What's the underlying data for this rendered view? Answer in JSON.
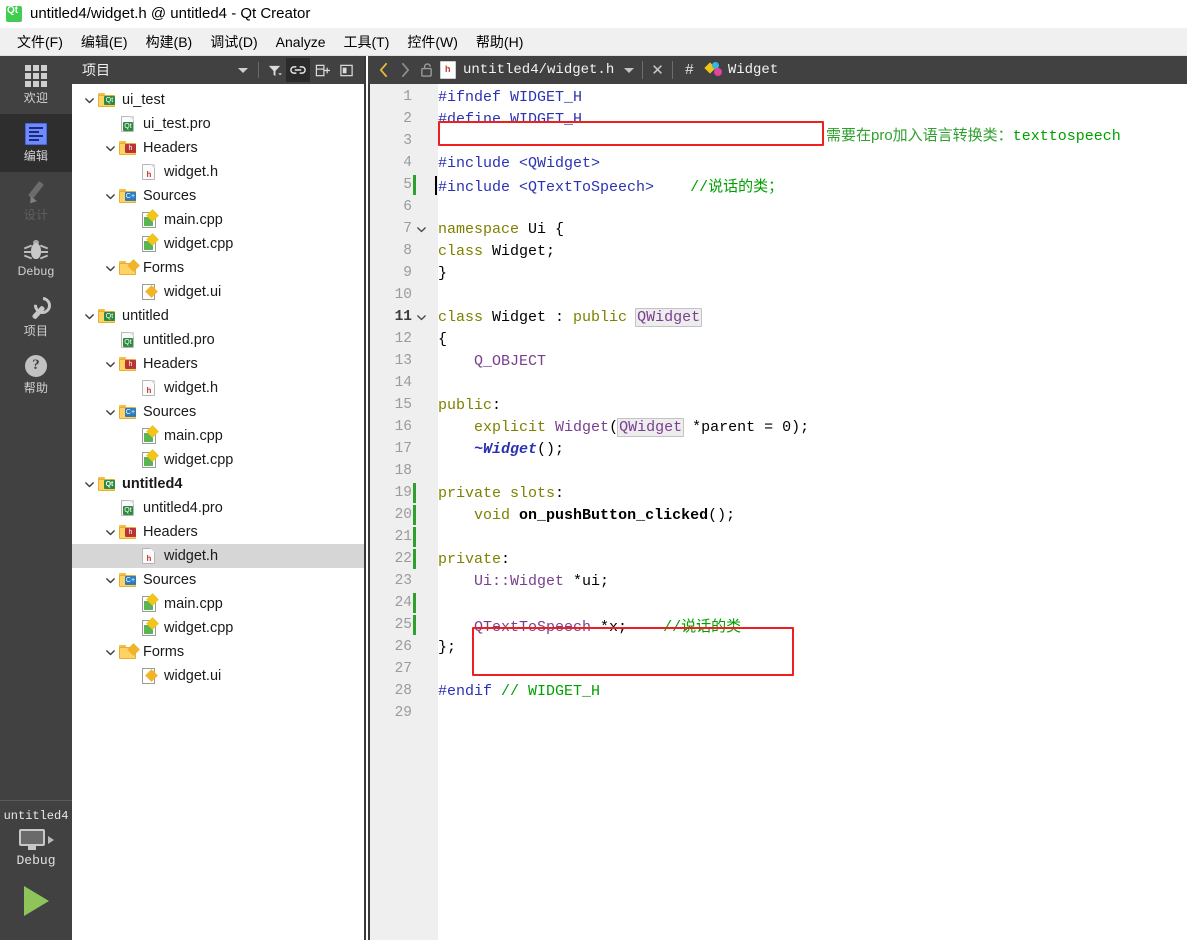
{
  "window": {
    "title": "untitled4/widget.h @ untitled4 - Qt Creator",
    "logo_icon": "qt-logo-icon"
  },
  "menubar": {
    "items": [
      {
        "label": "文件(F)",
        "mnemonic": "F"
      },
      {
        "label": "编辑(E)",
        "mnemonic": "E"
      },
      {
        "label": "构建(B)",
        "mnemonic": "B"
      },
      {
        "label": "调试(D)",
        "mnemonic": "D"
      },
      {
        "label": "Analyze",
        "mnemonic": "A"
      },
      {
        "label": "工具(T)",
        "mnemonic": "T"
      },
      {
        "label": "控件(W)",
        "mnemonic": "W"
      },
      {
        "label": "帮助(H)",
        "mnemonic": "H"
      }
    ]
  },
  "modebar": {
    "items": [
      {
        "label": "欢迎",
        "icon": "grid-icon",
        "state": "normal"
      },
      {
        "label": "编辑",
        "icon": "edit-document-icon",
        "state": "active"
      },
      {
        "label": "设计",
        "icon": "pencil-icon",
        "state": "disabled"
      },
      {
        "label": "Debug",
        "icon": "bug-icon",
        "state": "normal"
      },
      {
        "label": "项目",
        "icon": "wrench-icon",
        "state": "normal"
      },
      {
        "label": "帮助",
        "icon": "question-circle-icon",
        "state": "normal"
      }
    ],
    "kit": {
      "project": "untitled4",
      "build_config": "Debug",
      "target_icon": "monitor-icon",
      "arrow_icon": "chevron-right-icon",
      "run_icon": "run-play-icon"
    }
  },
  "project_panel": {
    "title": "项目",
    "toolbar": [
      {
        "name": "view-selector-caret",
        "icon": "chevron-down-icon"
      },
      {
        "name": "filter-button",
        "icon": "filter-icon"
      },
      {
        "name": "sync-with-editor-button",
        "icon": "link-icon",
        "active": true
      },
      {
        "name": "add-split-button",
        "icon": "split-add-icon"
      },
      {
        "name": "close-sidebar-button",
        "icon": "close-panel-icon"
      }
    ],
    "tree": [
      {
        "indent": 0,
        "label": "ui_test",
        "icon": "folder-qt-icon",
        "twisty": "expanded",
        "bold": false,
        "selected": false
      },
      {
        "indent": 1,
        "label": "ui_test.pro",
        "icon": "file-pro-icon",
        "twisty": "none",
        "bold": false,
        "selected": false
      },
      {
        "indent": 1,
        "label": "Headers",
        "icon": "folder-h-icon",
        "twisty": "expanded",
        "bold": false,
        "selected": false
      },
      {
        "indent": 2,
        "label": "widget.h",
        "icon": "file-h-icon",
        "twisty": "none",
        "bold": false,
        "selected": false
      },
      {
        "indent": 1,
        "label": "Sources",
        "icon": "folder-cpp-icon",
        "twisty": "expanded",
        "bold": false,
        "selected": false
      },
      {
        "indent": 2,
        "label": "main.cpp",
        "icon": "file-cpp-icon",
        "twisty": "none",
        "bold": false,
        "selected": false
      },
      {
        "indent": 2,
        "label": "widget.cpp",
        "icon": "file-cpp-icon",
        "twisty": "none",
        "bold": false,
        "selected": false
      },
      {
        "indent": 1,
        "label": "Forms",
        "icon": "folder-forms-icon",
        "twisty": "expanded",
        "bold": false,
        "selected": false
      },
      {
        "indent": 2,
        "label": "widget.ui",
        "icon": "file-ui-icon",
        "twisty": "none",
        "bold": false,
        "selected": false
      },
      {
        "indent": 0,
        "label": "untitled",
        "icon": "folder-qt-icon",
        "twisty": "expanded",
        "bold": false,
        "selected": false
      },
      {
        "indent": 1,
        "label": "untitled.pro",
        "icon": "file-pro-icon",
        "twisty": "none",
        "bold": false,
        "selected": false
      },
      {
        "indent": 1,
        "label": "Headers",
        "icon": "folder-h-icon",
        "twisty": "expanded",
        "bold": false,
        "selected": false
      },
      {
        "indent": 2,
        "label": "widget.h",
        "icon": "file-h-icon",
        "twisty": "none",
        "bold": false,
        "selected": false
      },
      {
        "indent": 1,
        "label": "Sources",
        "icon": "folder-cpp-icon",
        "twisty": "expanded",
        "bold": false,
        "selected": false
      },
      {
        "indent": 2,
        "label": "main.cpp",
        "icon": "file-cpp-icon",
        "twisty": "none",
        "bold": false,
        "selected": false
      },
      {
        "indent": 2,
        "label": "widget.cpp",
        "icon": "file-cpp-icon",
        "twisty": "none",
        "bold": false,
        "selected": false
      },
      {
        "indent": 0,
        "label": "untitled4",
        "icon": "folder-qt-icon",
        "twisty": "expanded",
        "bold": true,
        "selected": false
      },
      {
        "indent": 1,
        "label": "untitled4.pro",
        "icon": "file-pro-icon",
        "twisty": "none",
        "bold": false,
        "selected": false
      },
      {
        "indent": 1,
        "label": "Headers",
        "icon": "folder-h-icon",
        "twisty": "expanded",
        "bold": false,
        "selected": false
      },
      {
        "indent": 2,
        "label": "widget.h",
        "icon": "file-h-icon",
        "twisty": "none",
        "bold": false,
        "selected": true
      },
      {
        "indent": 1,
        "label": "Sources",
        "icon": "folder-cpp-icon",
        "twisty": "expanded",
        "bold": false,
        "selected": false
      },
      {
        "indent": 2,
        "label": "main.cpp",
        "icon": "file-cpp-icon",
        "twisty": "none",
        "bold": false,
        "selected": false
      },
      {
        "indent": 2,
        "label": "widget.cpp",
        "icon": "file-cpp-icon",
        "twisty": "none",
        "bold": false,
        "selected": false
      },
      {
        "indent": 1,
        "label": "Forms",
        "icon": "folder-forms-icon",
        "twisty": "expanded",
        "bold": false,
        "selected": false
      },
      {
        "indent": 2,
        "label": "widget.ui",
        "icon": "file-ui-icon",
        "twisty": "none",
        "bold": false,
        "selected": false
      }
    ]
  },
  "editor": {
    "toolbar": {
      "back_icon": "chevron-left-icon",
      "forward_icon": "chevron-right-icon",
      "lock_icon": "unlocked-padlock-icon",
      "file_icon": "file-h-icon",
      "filename": "untitled4/widget.h",
      "dropdown_icon": "chevron-down-icon",
      "close_icon": "close-icon",
      "hash_label": "#",
      "symbol_icon": "class-symbol-icon",
      "symbol_name": "Widget"
    },
    "lines": [
      {
        "n": "1",
        "fold": "",
        "changed": false,
        "current": false,
        "tokens": [
          {
            "t": "#ifndef ",
            "c": "k-pre"
          },
          {
            "t": "WIDGET_H",
            "c": "k-pre"
          }
        ]
      },
      {
        "n": "2",
        "fold": "",
        "changed": false,
        "current": false,
        "tokens": [
          {
            "t": "#define ",
            "c": "k-pre"
          },
          {
            "t": "WIDGET_H",
            "c": "k-pre"
          }
        ]
      },
      {
        "n": "3",
        "fold": "",
        "changed": false,
        "current": false,
        "tokens": []
      },
      {
        "n": "4",
        "fold": "",
        "changed": false,
        "current": false,
        "tokens": [
          {
            "t": "#include ",
            "c": "k-pre"
          },
          {
            "t": "<QWidget>",
            "c": "k-pre"
          }
        ]
      },
      {
        "n": "5",
        "fold": "",
        "changed": true,
        "current": false,
        "tokens": [
          {
            "t": "#include ",
            "c": "k-pre"
          },
          {
            "t": "<QTextToSpeech>",
            "c": "k-pre"
          },
          {
            "t": "    ",
            "c": "k-plain"
          },
          {
            "t": "//说话的类；",
            "c": "k-cmt"
          }
        ]
      },
      {
        "n": "6",
        "fold": "",
        "changed": false,
        "current": false,
        "tokens": []
      },
      {
        "n": "7",
        "fold": "open",
        "changed": false,
        "current": false,
        "tokens": [
          {
            "t": "namespace",
            "c": "k-kw"
          },
          {
            "t": " Ui {",
            "c": "k-plain"
          }
        ]
      },
      {
        "n": "8",
        "fold": "",
        "changed": false,
        "current": false,
        "tokens": [
          {
            "t": "class",
            "c": "k-kw"
          },
          {
            "t": " Widget;",
            "c": "k-plain"
          }
        ]
      },
      {
        "n": "9",
        "fold": "",
        "changed": false,
        "current": false,
        "tokens": [
          {
            "t": "}",
            "c": "k-plain"
          }
        ]
      },
      {
        "n": "10",
        "fold": "",
        "changed": false,
        "current": false,
        "tokens": []
      },
      {
        "n": "11",
        "fold": "open",
        "changed": false,
        "current": true,
        "tokens": [
          {
            "t": "class",
            "c": "k-kw"
          },
          {
            "t": " Widget : ",
            "c": "k-plain"
          },
          {
            "t": "public",
            "c": "k-kw"
          },
          {
            "t": " ",
            "c": "k-plain"
          },
          {
            "t": "QWidget",
            "c": "occur"
          }
        ]
      },
      {
        "n": "12",
        "fold": "",
        "changed": false,
        "current": false,
        "tokens": [
          {
            "t": "{",
            "c": "k-plain"
          }
        ]
      },
      {
        "n": "13",
        "fold": "",
        "changed": false,
        "current": false,
        "tokens": [
          {
            "t": "    Q_OBJECT",
            "c": "k-type"
          }
        ]
      },
      {
        "n": "14",
        "fold": "",
        "changed": false,
        "current": false,
        "tokens": []
      },
      {
        "n": "15",
        "fold": "",
        "changed": false,
        "current": false,
        "tokens": [
          {
            "t": "public",
            "c": "k-kw"
          },
          {
            "t": ":",
            "c": "k-plain"
          }
        ]
      },
      {
        "n": "16",
        "fold": "",
        "changed": false,
        "current": false,
        "tokens": [
          {
            "t": "    ",
            "c": "k-plain"
          },
          {
            "t": "explicit",
            "c": "k-kw"
          },
          {
            "t": " ",
            "c": "k-plain"
          },
          {
            "t": "Widget",
            "c": "k-type"
          },
          {
            "t": "(",
            "c": "k-plain"
          },
          {
            "t": "QWidget",
            "c": "occur"
          },
          {
            "t": " *parent = 0);",
            "c": "k-plain"
          }
        ]
      },
      {
        "n": "17",
        "fold": "",
        "changed": false,
        "current": false,
        "tokens": [
          {
            "t": "    ~",
            "c": "k-dtor"
          },
          {
            "t": "Widget",
            "c": "k-dtor"
          },
          {
            "t": "();",
            "c": "k-plain"
          }
        ]
      },
      {
        "n": "18",
        "fold": "",
        "changed": false,
        "current": false,
        "tokens": []
      },
      {
        "n": "19",
        "fold": "",
        "changed": true,
        "current": false,
        "tokens": [
          {
            "t": "private slots",
            "c": "k-kw"
          },
          {
            "t": ":",
            "c": "k-plain"
          }
        ]
      },
      {
        "n": "20",
        "fold": "",
        "changed": true,
        "current": false,
        "tokens": [
          {
            "t": "    ",
            "c": "k-plain"
          },
          {
            "t": "void",
            "c": "k-kw"
          },
          {
            "t": " ",
            "c": "k-plain"
          },
          {
            "t": "on_pushButton_clicked",
            "c": "k-fn"
          },
          {
            "t": "();",
            "c": "k-plain"
          }
        ]
      },
      {
        "n": "21",
        "fold": "",
        "changed": true,
        "current": false,
        "tokens": []
      },
      {
        "n": "22",
        "fold": "",
        "changed": true,
        "current": false,
        "tokens": [
          {
            "t": "private",
            "c": "k-kw"
          },
          {
            "t": ":",
            "c": "k-plain"
          }
        ]
      },
      {
        "n": "23",
        "fold": "",
        "changed": false,
        "current": false,
        "tokens": [
          {
            "t": "    ",
            "c": "k-plain"
          },
          {
            "t": "Ui::Widget",
            "c": "k-type"
          },
          {
            "t": " *ui;",
            "c": "k-plain"
          }
        ]
      },
      {
        "n": "24",
        "fold": "",
        "changed": true,
        "current": false,
        "tokens": []
      },
      {
        "n": "25",
        "fold": "",
        "changed": true,
        "current": false,
        "tokens": [
          {
            "t": "    ",
            "c": "k-plain"
          },
          {
            "t": "QTextToSpeech",
            "c": "k-type"
          },
          {
            "t": " *x;",
            "c": "k-plain"
          },
          {
            "t": "    ",
            "c": "k-plain"
          },
          {
            "t": "//说话的类",
            "c": "k-cmt"
          }
        ]
      },
      {
        "n": "26",
        "fold": "",
        "changed": false,
        "current": false,
        "tokens": [
          {
            "t": "};",
            "c": "k-plain"
          }
        ]
      },
      {
        "n": "27",
        "fold": "",
        "changed": false,
        "current": false,
        "tokens": []
      },
      {
        "n": "28",
        "fold": "",
        "changed": false,
        "current": false,
        "tokens": [
          {
            "t": "#endif ",
            "c": "k-pre"
          },
          {
            "t": "// WIDGET_H",
            "c": "k-cmt"
          }
        ]
      },
      {
        "n": "29",
        "fold": "",
        "changed": false,
        "current": false,
        "tokens": []
      }
    ],
    "annotations": [
      {
        "name": "annotation-include-note",
        "text_cn": "需要在pro加入语言转换类：",
        "text_en": "texttospeech"
      }
    ],
    "highlight_boxes": [
      {
        "name": "redbox-include-line",
        "color": "#f01f1f"
      },
      {
        "name": "redbox-member-line",
        "color": "#f01f1f"
      }
    ]
  }
}
